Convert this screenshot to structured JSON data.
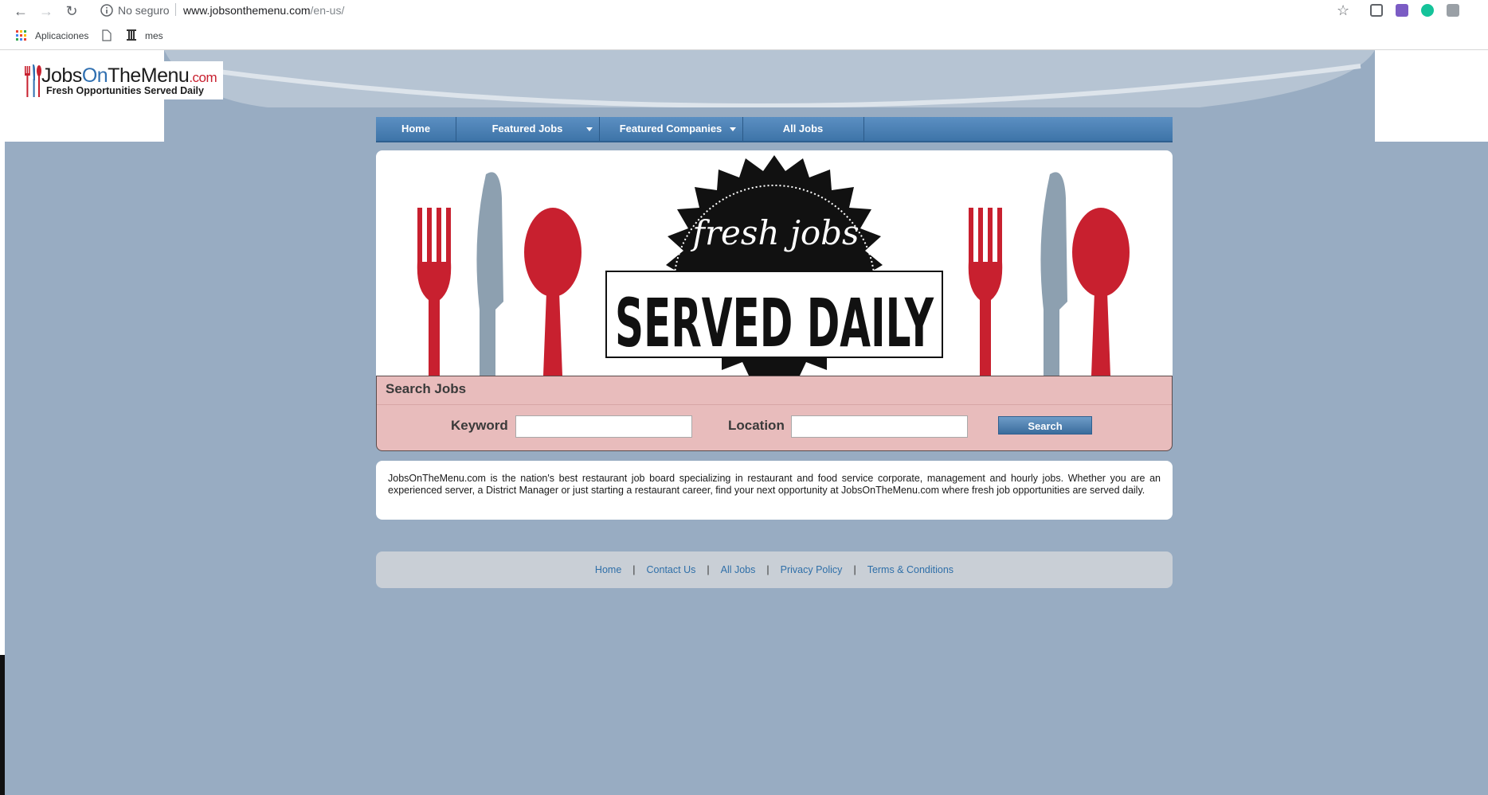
{
  "browser": {
    "security": "No seguro",
    "url_host": "www.jobsonthemenu.com",
    "url_path": "/en-us/",
    "bookmarks": [
      "Aplicaciones",
      "mes"
    ]
  },
  "logo": {
    "name_part1": "Jobs",
    "name_part2": "On",
    "name_part3": "The",
    "name_part4": "Menu",
    "name_suffix": ".com",
    "tagline": "Fresh Opportunities Served Daily"
  },
  "nav": {
    "items": [
      {
        "label": "Home"
      },
      {
        "label": "Featured Jobs"
      },
      {
        "label": "Featured Companies"
      },
      {
        "label": "All Jobs"
      }
    ]
  },
  "hero": {
    "script_text": "fresh jobs",
    "headline": "SERVED DAILY"
  },
  "search": {
    "title": "Search Jobs",
    "keyword_label": "Keyword",
    "keyword_value": "",
    "location_label": "Location",
    "location_value": "",
    "button_label": "Search"
  },
  "about": {
    "text": "JobsOnTheMenu.com is the nation's best restaurant job board specializing in restaurant and food service corporate, management and hourly jobs. Whether you are an experienced server, a District Manager or just starting a restaurant career, find your next opportunity at JobsOnTheMenu.com where fresh job opportunities are served daily."
  },
  "footer": {
    "links": [
      {
        "label": "Home"
      },
      {
        "label": "Contact Us"
      },
      {
        "label": "All Jobs"
      },
      {
        "label": "Privacy Policy"
      },
      {
        "label": "Terms & Conditions"
      }
    ],
    "separator": "|"
  },
  "colors": {
    "page_bg": "#98acc2",
    "nav_blue": "#4a80b4",
    "utensil_red": "#c8202f",
    "utensil_grey": "#8da0b0",
    "search_bg": "#e8bcbc"
  }
}
